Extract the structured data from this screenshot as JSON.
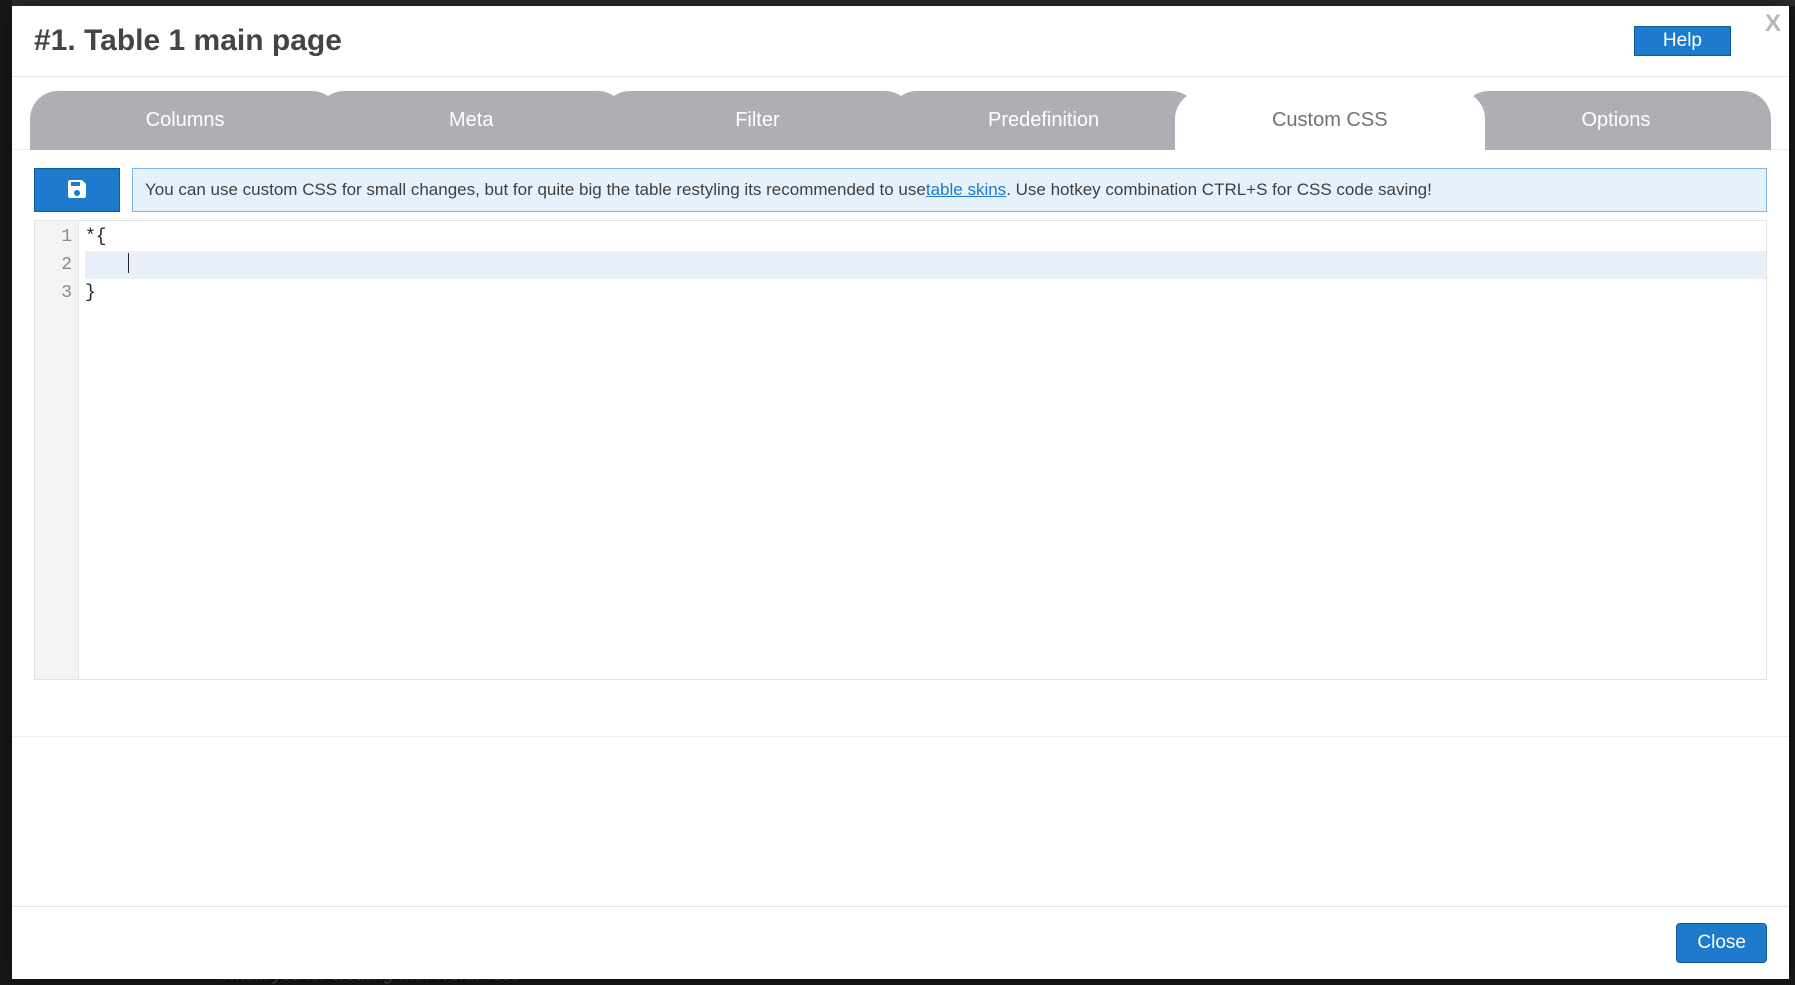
{
  "backdrop": {
    "footer_text": "Thank you for creating with WordPress"
  },
  "modal": {
    "title": "#1. Table 1 main page",
    "help_label": "Help",
    "close_x": "X",
    "close_label": "Close"
  },
  "tabs": [
    {
      "label": "Columns",
      "active": false
    },
    {
      "label": "Meta",
      "active": false
    },
    {
      "label": "Filter",
      "active": false
    },
    {
      "label": "Predefinition",
      "active": false
    },
    {
      "label": "Custom CSS",
      "active": true
    },
    {
      "label": "Options",
      "active": false
    }
  ],
  "info": {
    "before_link": "You can use custom CSS for small changes, but for quite big the table restyling its recommended to use ",
    "link_text": "table skins",
    "after_link": ". Use hotkey combination CTRL+S for CSS code saving!"
  },
  "editor": {
    "line_numbers": [
      "1",
      "2",
      "3"
    ],
    "lines": [
      "*{",
      "    ",
      "}"
    ],
    "active_line_index": 1
  },
  "icons": {
    "save": "save-icon"
  }
}
